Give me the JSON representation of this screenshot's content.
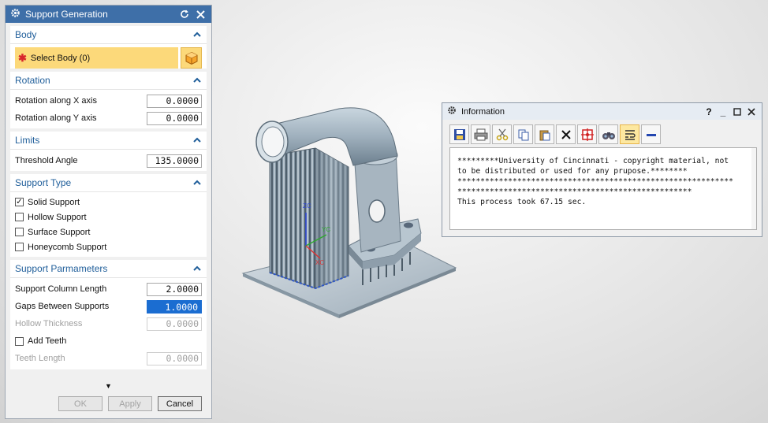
{
  "support_dialog": {
    "title": "Support Generation",
    "body_section": {
      "title": "Body",
      "select_label": "Select Body (0)"
    },
    "rotation_section": {
      "title": "Rotation",
      "x_label": "Rotation along X axis",
      "x_value": "0.0000",
      "y_label": "Rotation along Y axis",
      "y_value": "0.0000"
    },
    "limits_section": {
      "title": "Limits",
      "threshold_label": "Threshold Angle",
      "threshold_value": "135.0000"
    },
    "support_type_section": {
      "title": "Support Type",
      "options": [
        {
          "label": "Solid Support",
          "checked": true
        },
        {
          "label": "Hollow Support",
          "checked": false
        },
        {
          "label": "Surface Support",
          "checked": false
        },
        {
          "label": "Honeycomb Support",
          "checked": false
        }
      ]
    },
    "support_params_section": {
      "title": "Support Parmameters",
      "column_length_label": "Support Column Length",
      "column_length_value": "2.0000",
      "gaps_label": "Gaps Between Supports",
      "gaps_value": "1.0000",
      "hollow_thickness_label": "Hollow Thickness",
      "hollow_thickness_value": "0.0000",
      "add_teeth_label": "Add Teeth",
      "teeth_length_label": "Teeth Length",
      "teeth_length_value": "0.0000"
    },
    "buttons": {
      "ok": "OK",
      "apply": "Apply",
      "cancel": "Cancel"
    }
  },
  "info_dialog": {
    "title": "Information",
    "title_buttons": [
      "?",
      "_"
    ],
    "text_lines": [
      "*********University of Cincinnati - copyright material, not",
      "to be distributed or used for any prupose.********",
      "************************************************************",
      "***************************************************",
      "This process took 67.15 sec."
    ]
  },
  "viewport": {
    "axis_labels": {
      "z": "ZC",
      "y": "YC",
      "x": "XC"
    }
  },
  "colors": {
    "title_blue": "#3e6fa8",
    "section_blue": "#1f5e9a",
    "select_yellow": "#fcd97a",
    "selection_blue": "#1b6dd1"
  }
}
